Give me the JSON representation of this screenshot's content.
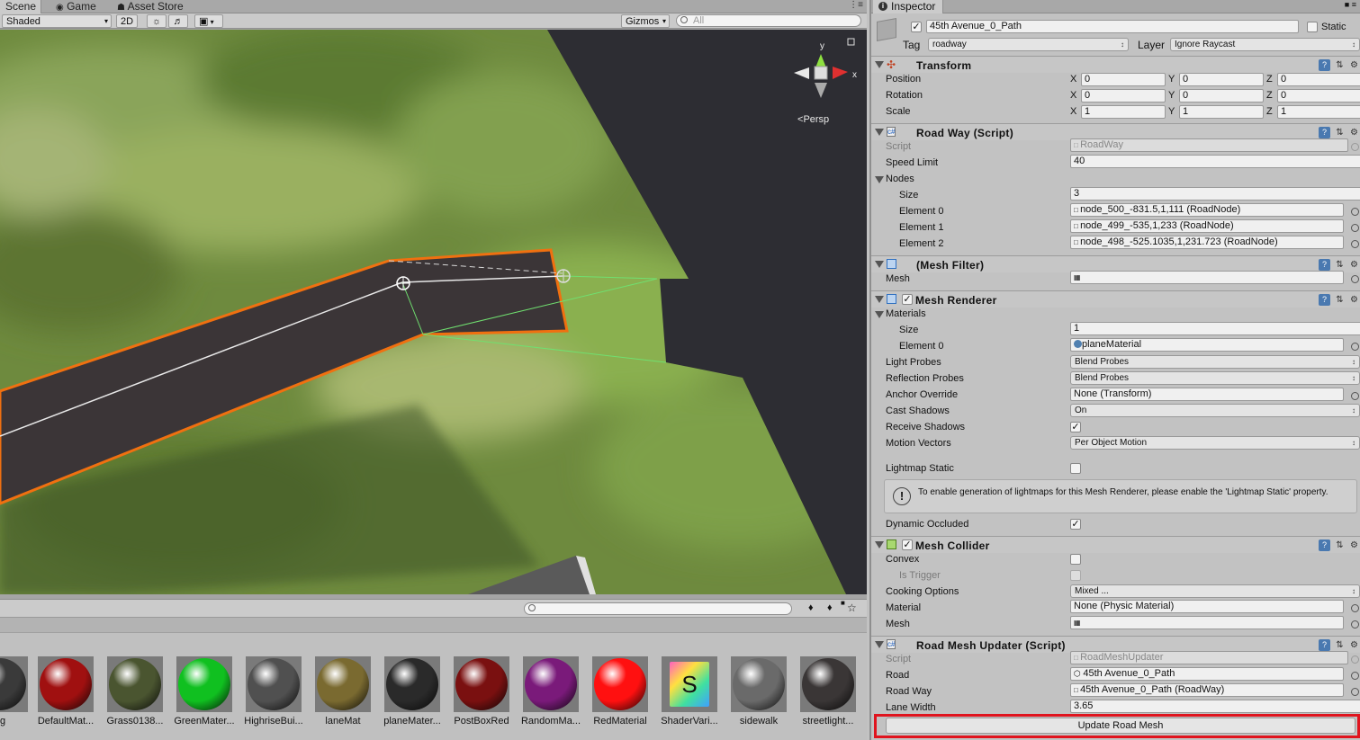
{
  "scene": {
    "tabs": [
      "Scene",
      "Game",
      "Asset Store"
    ],
    "shading": "Shaded",
    "mode2d": "2D",
    "gizmos": "Gizmos",
    "search_placeholder": "All",
    "persp_label": "Persp",
    "gizmo_axes": [
      "y",
      "x"
    ]
  },
  "project": {
    "assets": [
      {
        "name": "ng",
        "color": "#3a3a3a"
      },
      {
        "name": "DefaultMat...",
        "color": "#a01010"
      },
      {
        "name": "Grass0138...",
        "color": "#4a5530"
      },
      {
        "name": "GreenMater...",
        "color": "#10c020"
      },
      {
        "name": "HighriseBui...",
        "color": "#505050"
      },
      {
        "name": "laneMat",
        "color": "#7a6a30"
      },
      {
        "name": "planeMater...",
        "color": "#2a2a2a"
      },
      {
        "name": "PostBoxRed",
        "color": "#7a1010"
      },
      {
        "name": "RandomMa...",
        "color": "#7a1a7a"
      },
      {
        "name": "RedMaterial",
        "color": "#ff1010"
      },
      {
        "name": "ShaderVari...",
        "color": "#ffffff"
      },
      {
        "name": "sidewalk",
        "color": "#6a6a6a"
      },
      {
        "name": "streetlight...",
        "color": "#3a3636"
      }
    ]
  },
  "inspector": {
    "tab": "Inspector",
    "object_name": "45th Avenue_0_Path",
    "static_label": "Static",
    "tag_label": "Tag",
    "tag_value": "roadway",
    "layer_label": "Layer",
    "layer_value": "Ignore Raycast",
    "transform": {
      "title": "Transform",
      "position_label": "Position",
      "rotation_label": "Rotation",
      "scale_label": "Scale",
      "position": [
        "0",
        "0",
        "0"
      ],
      "rotation": [
        "0",
        "0",
        "0"
      ],
      "scale": [
        "1",
        "1",
        "1"
      ]
    },
    "roadway": {
      "title": "Road Way (Script)",
      "script_label": "Script",
      "script_value": "RoadWay",
      "speed_label": "Speed Limit",
      "speed_value": "40",
      "nodes_label": "Nodes",
      "size_label": "Size",
      "size_value": "3",
      "elements": [
        {
          "label": "Element 0",
          "value": "node_500_-831.5,1,111 (RoadNode)"
        },
        {
          "label": "Element 1",
          "value": "node_499_-535,1,233 (RoadNode)"
        },
        {
          "label": "Element 2",
          "value": "node_498_-525.1035,1,231.723 (RoadNode)"
        }
      ]
    },
    "meshfilter": {
      "title": "(Mesh Filter)",
      "mesh_label": "Mesh"
    },
    "meshrenderer": {
      "title": "Mesh Renderer",
      "materials_label": "Materials",
      "size_label": "Size",
      "size_value": "1",
      "element0_label": "Element 0",
      "element0_value": "planeMaterial",
      "light_probes_label": "Light Probes",
      "light_probes_value": "Blend Probes",
      "reflection_label": "Reflection Probes",
      "reflection_value": "Blend Probes",
      "anchor_label": "Anchor Override",
      "anchor_value": "None (Transform)",
      "cast_label": "Cast Shadows",
      "cast_value": "On",
      "receive_label": "Receive Shadows",
      "motion_label": "Motion Vectors",
      "motion_value": "Per Object Motion",
      "lightmap_label": "Lightmap Static",
      "warning": "To enable generation of lightmaps for this Mesh Renderer, please enable the 'Lightmap Static' property.",
      "occluded_label": "Dynamic Occluded"
    },
    "meshcollider": {
      "title": "Mesh Collider",
      "convex_label": "Convex",
      "trigger_label": "Is Trigger",
      "cooking_label": "Cooking Options",
      "cooking_value": "Mixed ...",
      "material_label": "Material",
      "material_value": "None (Physic Material)",
      "mesh_label": "Mesh"
    },
    "updater": {
      "title": "Road Mesh Updater (Script)",
      "script_label": "Script",
      "script_value": "RoadMeshUpdater",
      "road_label": "Road",
      "road_value": "45th Avenue_0_Path",
      "roadway_label": "Road Way",
      "roadway_value": "45th Avenue_0_Path (RoadWay)",
      "lane_label": "Lane Width",
      "lane_value": "3.65",
      "button": "Update Road Mesh"
    }
  }
}
